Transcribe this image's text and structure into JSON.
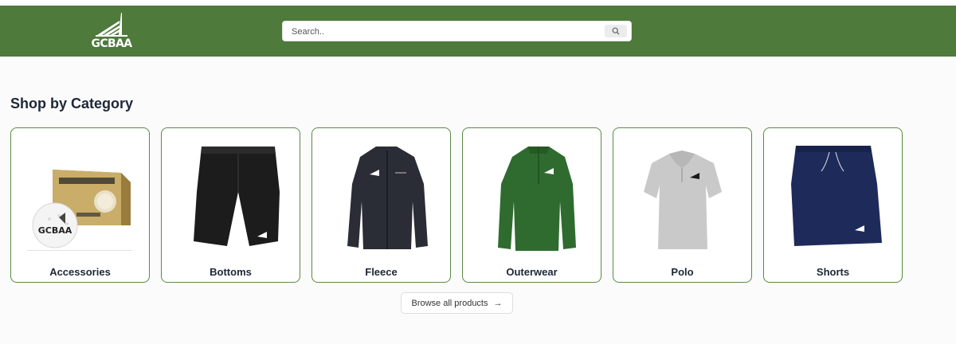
{
  "header": {
    "logo_text": "GCBAA",
    "search_placeholder": "Search.."
  },
  "main": {
    "section_title": "Shop by Category",
    "categories": [
      {
        "label": "Accessories"
      },
      {
        "label": "Bottoms"
      },
      {
        "label": "Fleece"
      },
      {
        "label": "Outerwear"
      },
      {
        "label": "Polo"
      },
      {
        "label": "Shorts"
      }
    ],
    "browse_label": "Browse all products",
    "browse_arrow": "→"
  },
  "icons": [
    "gcbaa-logo-icon",
    "search-icon",
    "arrow-right-icon"
  ],
  "colors": {
    "brand_green": "#4e7a3c",
    "card_border": "#5a8a44"
  }
}
